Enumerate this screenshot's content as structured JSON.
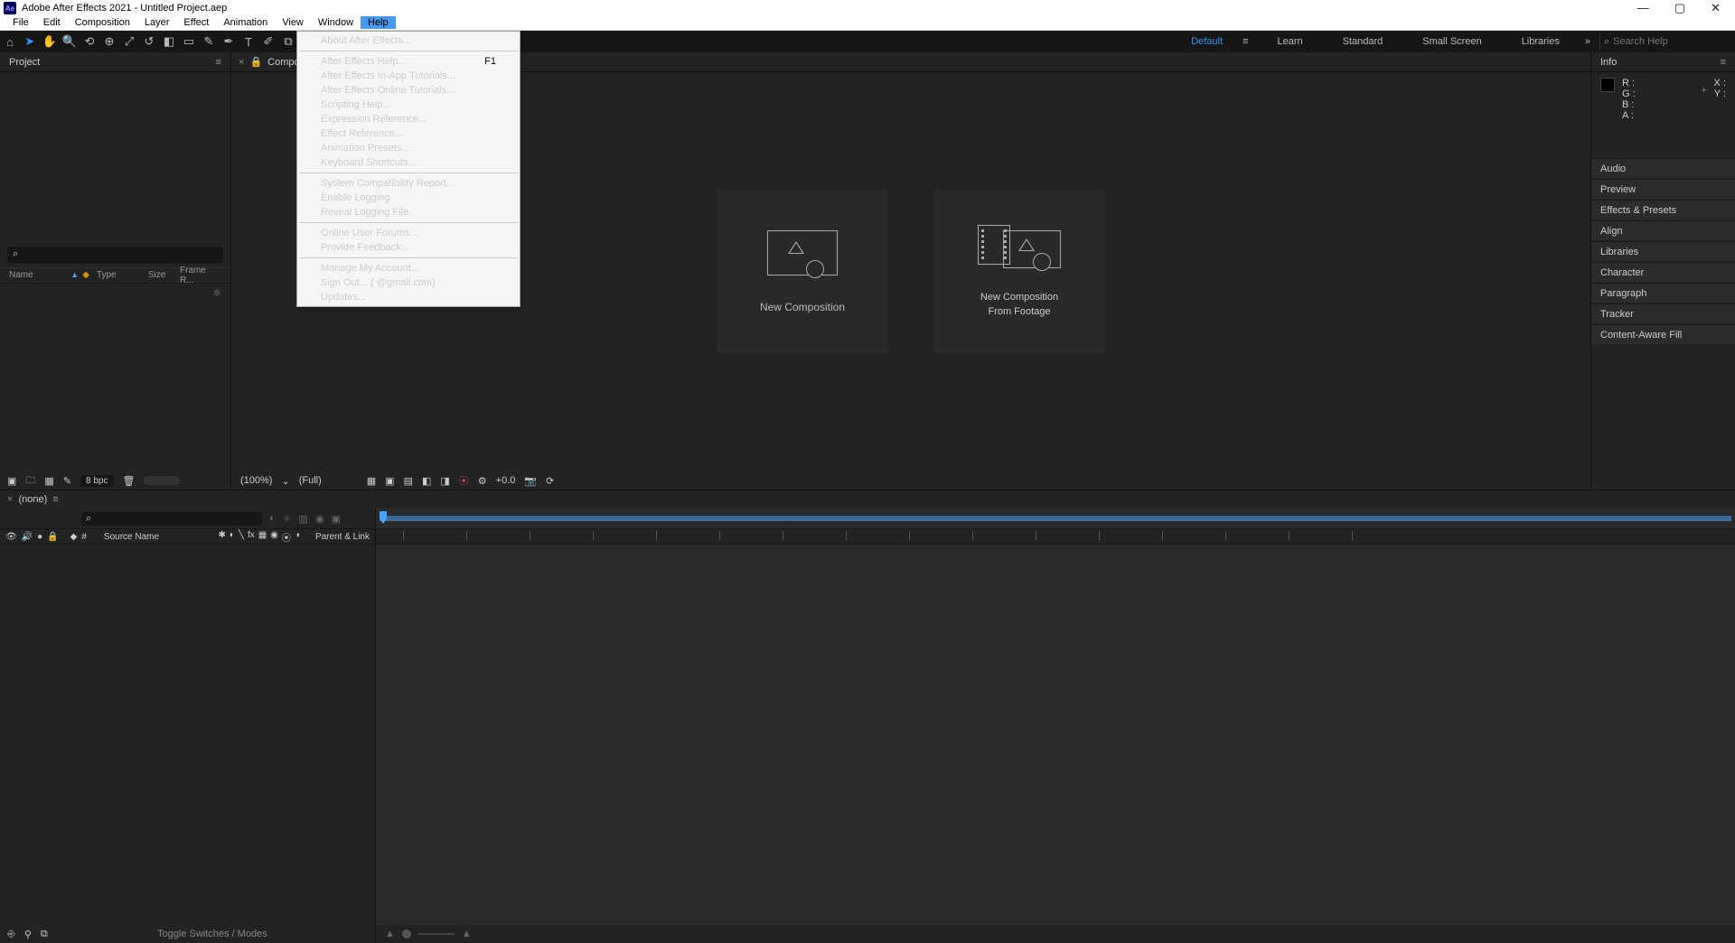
{
  "titlebar": {
    "app_logo": "Ae",
    "title": "Adobe After Effects 2021 - Untitled Project.aep",
    "min": "—",
    "max": "▢",
    "close": "✕"
  },
  "menubar": {
    "items": [
      "File",
      "Edit",
      "Composition",
      "Layer",
      "Effect",
      "Animation",
      "View",
      "Window",
      "Help"
    ],
    "active_index": 8
  },
  "toolbar": {
    "tools": [
      "⌂",
      "➤",
      "✋",
      "🔍",
      "⟲",
      "⊕",
      "⤢",
      "↺",
      "◧",
      "▭",
      "✎",
      "✒",
      "T",
      "✐",
      "⧉",
      "◆",
      "★",
      "⚲"
    ],
    "workspaces": [
      "Default",
      "Learn",
      "Standard",
      "Small Screen",
      "Libraries"
    ],
    "chev": "»",
    "search_placeholder": "Search Help"
  },
  "help_menu": {
    "g1": [
      "About After Effects..."
    ],
    "g2": [
      {
        "l": "After Effects Help...",
        "s": "F1"
      },
      {
        "l": "After Effects In-App Tutorials..."
      },
      {
        "l": "After Effects Online Tutorials..."
      },
      {
        "l": "Scripting Help..."
      },
      {
        "l": "Expression Reference..."
      },
      {
        "l": "Effect Reference..."
      },
      {
        "l": "Animation Presets..."
      },
      {
        "l": "Keyboard Shortcuts..."
      }
    ],
    "g3": [
      "System Compatibility Report...",
      "Enable Logging",
      "Reveal Logging File"
    ],
    "g4": [
      "Online User Forums...",
      "Provide Feedback..."
    ],
    "g5": [
      "Manage My Account...",
      "Sign Out... (                    @gmail.com)",
      "Updates..."
    ]
  },
  "project": {
    "title": "Project",
    "cols": {
      "name": "Name",
      "type": "Type",
      "size": "Size",
      "frame": "Frame R..."
    },
    "bpc": "8 bpc"
  },
  "comp": {
    "tab": "Compositi",
    "card1": "New Composition",
    "card2a": "New Composition",
    "card2b": "From Footage",
    "zoom": "(100%)",
    "res": "(Full)",
    "time": "+0.0"
  },
  "rpanel": {
    "info": "Info",
    "rgba": {
      "r": "R :",
      "g": "G :",
      "b": "B :",
      "a": "A :"
    },
    "xy": {
      "x": "X :",
      "y": "Y :"
    },
    "panels": [
      "Audio",
      "Preview",
      "Effects & Presets",
      "Align",
      "Libraries",
      "Character",
      "Paragraph",
      "Tracker",
      "Content-Aware Fill"
    ]
  },
  "timeline": {
    "tab": "(none)",
    "src": "Source Name",
    "parent": "Parent & Link",
    "toggle": "Toggle Switches / Modes"
  }
}
